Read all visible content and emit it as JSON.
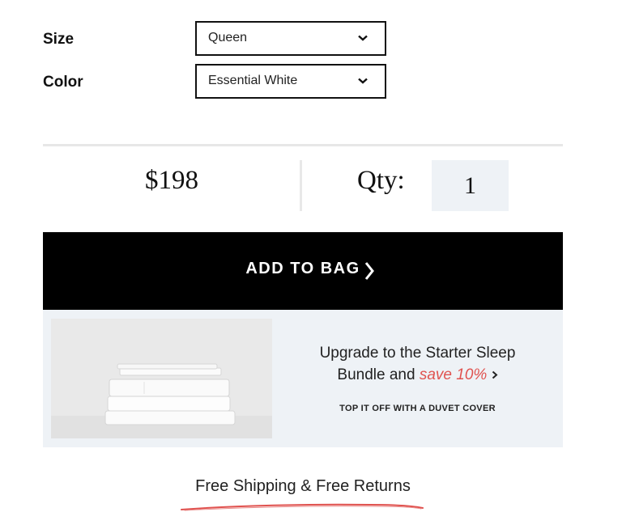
{
  "options": {
    "size": {
      "label": "Size",
      "value": "Queen"
    },
    "color": {
      "label": "Color",
      "value": "Essential White"
    }
  },
  "purchase": {
    "price": "$198",
    "qty_label": "Qty:",
    "qty_value": "1",
    "add_to_bag_label": "ADD TO BAG"
  },
  "promo": {
    "title_prefix": "Upgrade to the Starter Sleep",
    "title_line2": "Bundle and",
    "save_text": "save 10%",
    "subtitle": "TOP IT OFF WITH A DUVET COVER",
    "image": "folded-white-sheets-stack"
  },
  "footer": {
    "shipping_text": "Free Shipping & Free Returns"
  },
  "colors": {
    "accent_red": "#e0524f",
    "button_black": "#000000",
    "banner_bg": "#eef2f6"
  },
  "icons": {
    "select_chevron": "chevron-down-icon",
    "add_arrow": "chevron-right-icon",
    "promo_arrow": "chevron-right-icon"
  }
}
